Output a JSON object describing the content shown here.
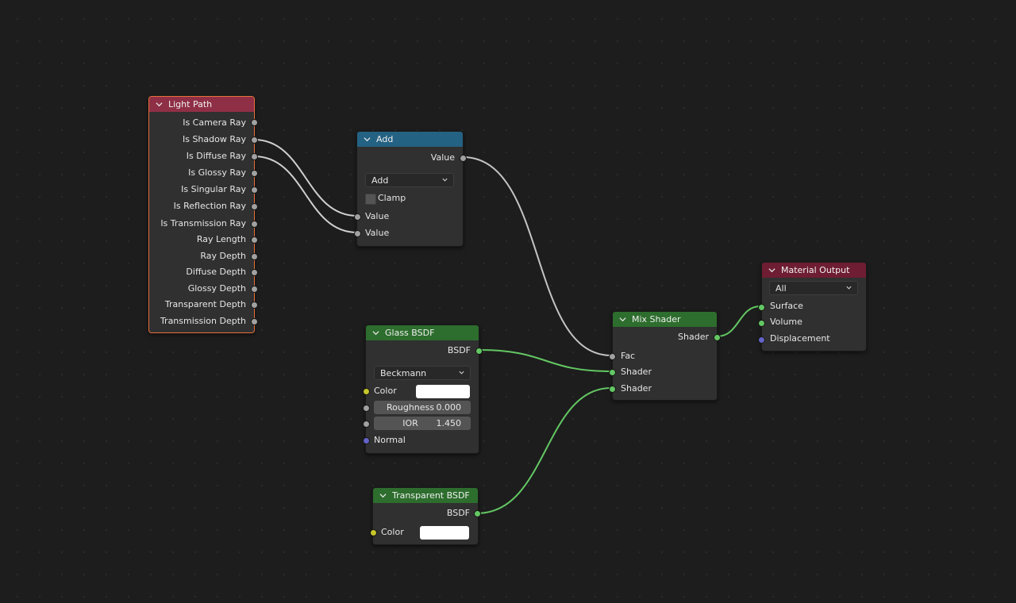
{
  "colors": {
    "background": "#1d1d1d",
    "node_body": "#303030",
    "header_input": "#8f2f46",
    "header_converter": "#246283",
    "header_shader": "#2d6d2d",
    "header_output": "#6e1d33",
    "selected_outline": "#e8703a",
    "socket_float": "#a1a1a1",
    "socket_shader": "#63c763",
    "socket_color": "#c7c729",
    "socket_vector": "#6363c7"
  },
  "nodes": {
    "light_path": {
      "title": "Light Path",
      "outputs": [
        "Is Camera Ray",
        "Is Shadow Ray",
        "Is Diffuse Ray",
        "Is Glossy Ray",
        "Is Singular Ray",
        "Is Reflection Ray",
        "Is Transmission Ray",
        "Ray Length",
        "Ray Depth",
        "Diffuse Depth",
        "Glossy Depth",
        "Transparent Depth",
        "Transmission Depth"
      ]
    },
    "add": {
      "title": "Add",
      "output": "Value",
      "operation": "Add",
      "clamp_label": "Clamp",
      "inputs": [
        "Value",
        "Value"
      ]
    },
    "glass": {
      "title": "Glass BSDF",
      "output": "BSDF",
      "distribution": "Beckmann",
      "color_label": "Color",
      "roughness_label": "Roughness",
      "roughness_value": "0.000",
      "ior_label": "IOR",
      "ior_value": "1.450",
      "normal_label": "Normal"
    },
    "transparent": {
      "title": "Transparent BSDF",
      "output": "BSDF",
      "color_label": "Color"
    },
    "mix": {
      "title": "Mix Shader",
      "output": "Shader",
      "inputs": [
        "Fac",
        "Shader",
        "Shader"
      ]
    },
    "material_output": {
      "title": "Material Output",
      "target": "All",
      "inputs": [
        "Surface",
        "Volume",
        "Displacement"
      ]
    }
  }
}
